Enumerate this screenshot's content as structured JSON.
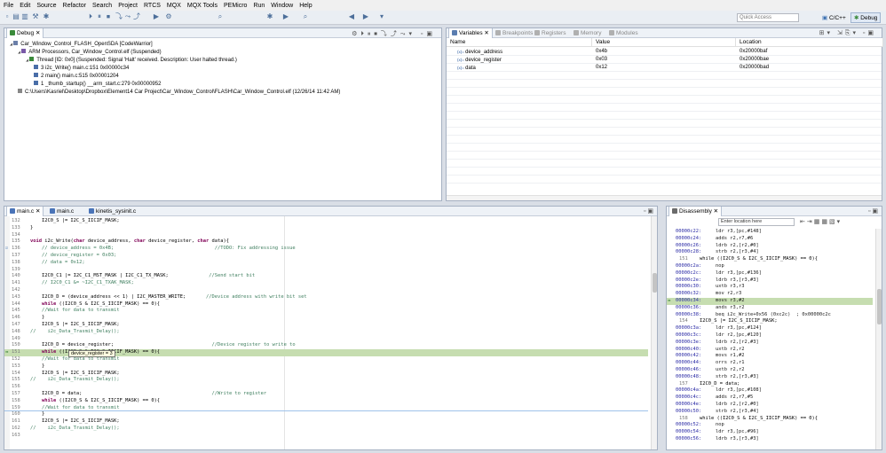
{
  "menu": [
    "File",
    "Edit",
    "Source",
    "Refactor",
    "Search",
    "Project",
    "RTCS",
    "MQX",
    "MQX Tools",
    "PEMicro",
    "Run",
    "Window",
    "Help"
  ],
  "toolbar": {
    "quick_access_placeholder": "Quick Access",
    "perspectives": [
      "C/C++",
      "Debug"
    ]
  },
  "debug_view": {
    "tab_label": "Debug",
    "tree": [
      {
        "indent": 0,
        "icon": "launch-icon",
        "text": "Car_Window_Control_FLASH_OpenSDA [CodeWarrior]"
      },
      {
        "indent": 1,
        "icon": "process-icon",
        "text": "ARM Processors, Car_Window_Control.elf (Suspended)"
      },
      {
        "indent": 2,
        "icon": "thread-icon",
        "text": "Thread [ID: 0x0] (Suspended: Signal 'Halt' received. Description: User halted thread.)"
      },
      {
        "indent": 3,
        "icon": "frame-icon",
        "text": "3 i2c_Write() main.c:151 0x00000c34"
      },
      {
        "indent": 3,
        "icon": "frame-icon",
        "text": "2 main() main.c:515 0x00001204"
      },
      {
        "indent": 3,
        "icon": "frame-icon",
        "text": "1 _thumb_startup() __arm_start.c:279 0x00000952"
      },
      {
        "indent": 1,
        "icon": "elf-icon",
        "text": "C:\\Users\\Kasriel\\Desktop\\Dropbox\\Element14 Car Project\\Car_Window_Control\\FLASH\\Car_Window_Control.elf (12/26/14 11:42 AM)"
      }
    ]
  },
  "variables_view": {
    "tabs": [
      "Variables",
      "Breakpoints",
      "Registers",
      "Memory",
      "Modules"
    ],
    "columns": [
      "Name",
      "Value",
      "Location"
    ],
    "rows": [
      {
        "name": "device_address",
        "value": "0x4b",
        "location": "0x20000baf"
      },
      {
        "name": "device_register",
        "value": "0x03",
        "location": "0x20000bae"
      },
      {
        "name": "data",
        "value": "0x12",
        "location": "0x20000bad"
      }
    ]
  },
  "editor": {
    "tabs": [
      "main.c",
      "main.c",
      "kinetis_sysinit.c"
    ],
    "tooltip": "device_register = 3",
    "lines": [
      {
        "n": "132",
        "t": "    I2C0_S |= I2C_S_IICIF_MASK;"
      },
      {
        "n": "133",
        "t": "}"
      },
      {
        "n": "134",
        "t": ""
      },
      {
        "n": "135",
        "t": "void i2c_Write(char device_address, char device_register, char data){"
      },
      {
        "n": "136",
        "t": "    // device_address = 0x4B;                                   //TODO: Fix addressing issue"
      },
      {
        "n": "137",
        "t": "    // device_register = 0x03;"
      },
      {
        "n": "138",
        "t": "    // data = 0x12;"
      },
      {
        "n": "139",
        "t": ""
      },
      {
        "n": "140",
        "t": "    I2C0_C1 |= I2C_C1_MST_MASK | I2C_C1_TX_MASK;              //Send start bit"
      },
      {
        "n": "141",
        "t": "    // I2C0_C1 &= ~I2C_C1_TXAK_MASK;"
      },
      {
        "n": "142",
        "t": ""
      },
      {
        "n": "143",
        "t": "    I2C0_D = (device_address << 1) | I2C_MASTER_WRITE;       //Device address with write bit set"
      },
      {
        "n": "144",
        "t": "    while ((I2C0_S & I2C_S_IICIF_MASK) == 0){"
      },
      {
        "n": "145",
        "t": "    //Wait for data to transmit"
      },
      {
        "n": "146",
        "t": "    }"
      },
      {
        "n": "147",
        "t": "    I2C0_S |= I2C_S_IICIF_MASK;"
      },
      {
        "n": "148",
        "t": "//    i2c_Data_Trasmit_Delay();"
      },
      {
        "n": "149",
        "t": ""
      },
      {
        "n": "150",
        "t": "    I2C0_D = device_register;                                  //Device register to write to"
      },
      {
        "n": "151",
        "t": "    while ((I2C0_S & I2C_S_IICIF_MASK) == 0){"
      },
      {
        "n": "152",
        "t": "    //Wait for data to transmit"
      },
      {
        "n": "153",
        "t": "    }"
      },
      {
        "n": "154",
        "t": "    I2C0_S |= I2C_S_IICIF_MASK;"
      },
      {
        "n": "155",
        "t": "//    i2c_Data_Trasmit_Delay();"
      },
      {
        "n": "156",
        "t": ""
      },
      {
        "n": "157",
        "t": "    I2C0_D = data;                                             //Write to register"
      },
      {
        "n": "158",
        "t": "    while ((I2C0_S & I2C_S_IICIF_MASK) == 0){"
      },
      {
        "n": "159",
        "t": "    //Wait for data to transmit"
      },
      {
        "n": "160",
        "t": "    }"
      },
      {
        "n": "161",
        "t": "    I2C0_S |= I2C_S_IICIF_MASK;"
      },
      {
        "n": "162",
        "t": "//    i2c_Data_Trasmit_Delay();"
      },
      {
        "n": "163",
        "t": ""
      }
    ]
  },
  "disassembly": {
    "tab_label": "Disassembly",
    "location_placeholder": "Enter location here",
    "lines": [
      {
        "a": "00000c22:",
        "t": "ldr r3,[pc,#148]"
      },
      {
        "a": "00000c24:",
        "t": "adds r2,r7,#6"
      },
      {
        "a": "00000c26:",
        "t": "ldrb r2,[r2,#0]"
      },
      {
        "a": "00000c28:",
        "t": "strb r2,[r3,#4]"
      },
      {
        "a": "151",
        "t": "    while ((I2C0_S & I2C_S_IICIF_MASK) == 0){"
      },
      {
        "a": "00000c2a:",
        "t": "nop"
      },
      {
        "a": "00000c2c:",
        "t": "ldr r3,[pc,#136]"
      },
      {
        "a": "00000c2e:",
        "t": "ldrb r3,[r3,#3]"
      },
      {
        "a": "00000c30:",
        "t": "uxtb r3,r3"
      },
      {
        "a": "00000c32:",
        "t": "mov r2,r3"
      },
      {
        "a": "00000c34:",
        "t": "movs r3,#2"
      },
      {
        "a": "00000c36:",
        "t": "ands r3,r2"
      },
      {
        "a": "00000c38:",
        "t": "beq i2c_Write+0x56 (0xc2c)  ; 0x00000c2c"
      },
      {
        "a": "154",
        "t": "    I2C0_S |= I2C_S_IICIF_MASK;"
      },
      {
        "a": "00000c3a:",
        "t": "ldr r3,[pc,#124]"
      },
      {
        "a": "00000c3c:",
        "t": "ldr r2,[pc,#120]"
      },
      {
        "a": "00000c3e:",
        "t": "ldrb r2,[r2,#3]"
      },
      {
        "a": "00000c40:",
        "t": "uxtb r2,r2"
      },
      {
        "a": "00000c42:",
        "t": "movs r1,#2"
      },
      {
        "a": "00000c44:",
        "t": "orrs r2,r1"
      },
      {
        "a": "00000c46:",
        "t": "uxtb r2,r2"
      },
      {
        "a": "00000c48:",
        "t": "strb r2,[r3,#3]"
      },
      {
        "a": "157",
        "t": "    I2C0_D = data;"
      },
      {
        "a": "00000c4a:",
        "t": "ldr r3,[pc,#108]"
      },
      {
        "a": "00000c4c:",
        "t": "adds r2,r7,#5"
      },
      {
        "a": "00000c4e:",
        "t": "ldrb r2,[r2,#0]"
      },
      {
        "a": "00000c50:",
        "t": "strb r2,[r3,#4]"
      },
      {
        "a": "158",
        "t": "    while ((I2C0_S & I2C_S_IICIF_MASK) == 0){"
      },
      {
        "a": "00000c52:",
        "t": "nop"
      },
      {
        "a": "00000c54:",
        "t": "ldr r3,[pc,#96]"
      },
      {
        "a": "00000c56:",
        "t": "ldrb r3,[r3,#3]"
      }
    ]
  },
  "colors": {
    "keyword": "#7f0055",
    "comment": "#3f7f5f",
    "current_line": "#c6ddb0",
    "selection": "#d4d4d4",
    "panel_border": "#a6b1c2"
  }
}
